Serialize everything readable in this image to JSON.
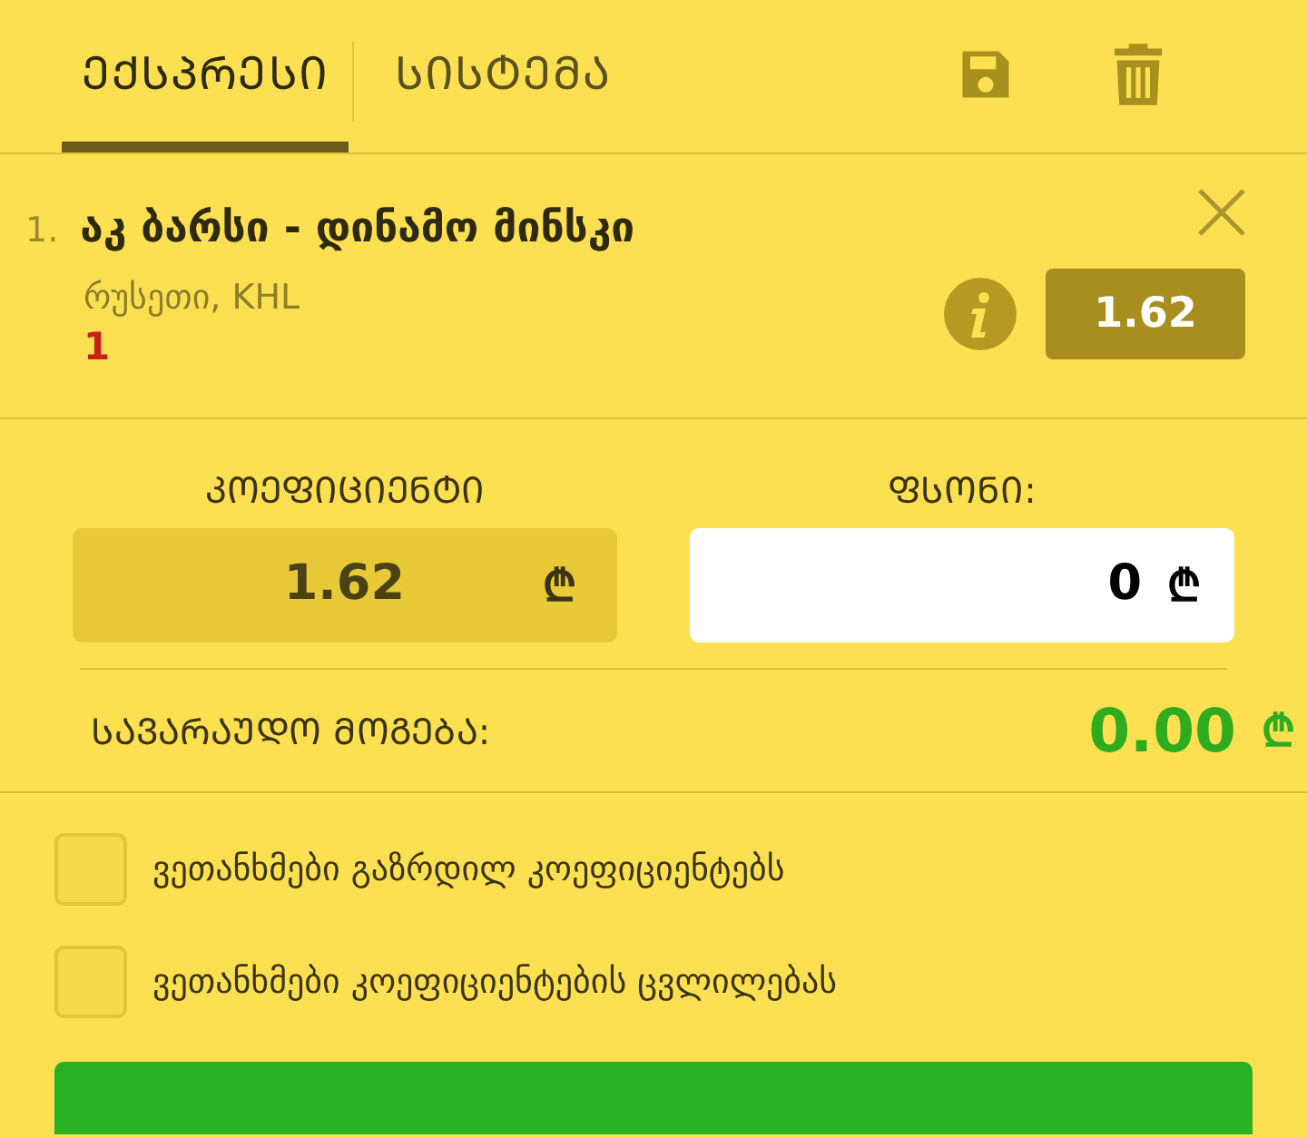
{
  "tabs": [
    {
      "label": "ᲔᲥᲡᲞᲠᲔᲡᲘ",
      "selected": true
    },
    {
      "label": "ᲡᲘᲡᲢᲔᲛᲐ",
      "selected": false
    }
  ],
  "bet": {
    "number": "1.",
    "match": "აკ ბარსი - დინამო მინსკი",
    "league": "რუსეთი, KHL",
    "outcome": "1",
    "odds": "1.62"
  },
  "coefficient": {
    "label": "ᲙᲝᲔᲤᲘᲪᲘᲔᲜᲢᲘ",
    "value": "1.62",
    "currency": "₾"
  },
  "stake": {
    "label": "ᲤᲡᲝᲜᲘ:",
    "value": "0",
    "currency": "₾"
  },
  "potential_win": {
    "label": "ᲡᲐᲕᲐᲠᲐᲣᲓᲝ ᲛᲝᲒᲔᲑᲐ:",
    "value": "0.00",
    "currency": "₾"
  },
  "agreements": [
    {
      "label": "ვეთანხმები გაზრდილ კოეფიციენტებს",
      "checked": false
    },
    {
      "label": "ვეთანხმები კოეფიციენტების ცვლილებას",
      "checked": false
    }
  ]
}
